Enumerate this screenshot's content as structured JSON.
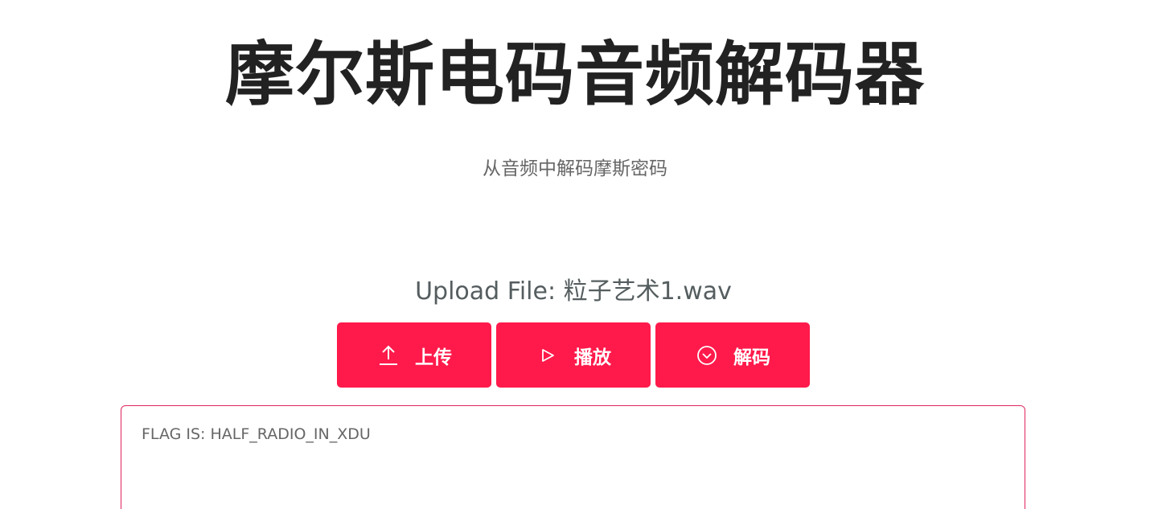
{
  "header": {
    "title": "摩尔斯电码音频解码器",
    "subtitle": "从音频中解码摩斯密码"
  },
  "upload": {
    "label": "Upload File: 粒子艺术1.wav"
  },
  "buttons": {
    "upload": {
      "label": "上传",
      "icon": "upload-icon"
    },
    "play": {
      "label": "播放",
      "icon": "play-icon"
    },
    "decode": {
      "label": "解码",
      "icon": "chevron-circle-down-icon"
    }
  },
  "output": {
    "text": "FLAG IS: HALF_RADIO_IN_XDU"
  },
  "colors": {
    "accent": "#ff1a4b",
    "title": "#222222",
    "muted": "#666666",
    "border": "#e0245e"
  }
}
